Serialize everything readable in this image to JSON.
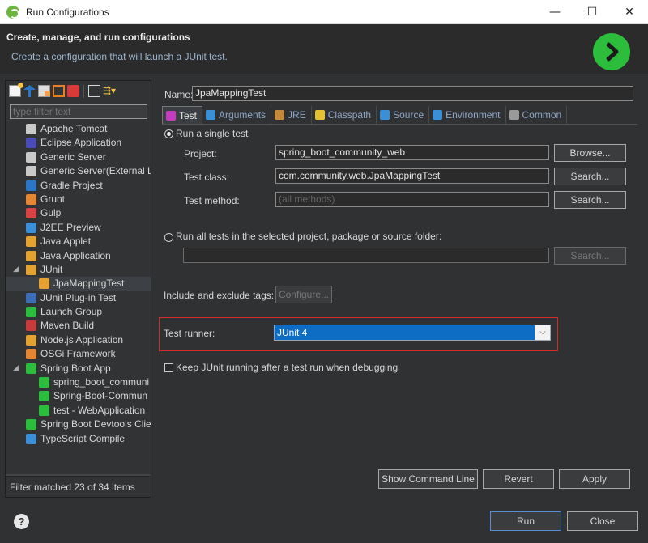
{
  "window": {
    "title": "Run Configurations",
    "minimize": "—",
    "maximize": "☐",
    "close": "✕"
  },
  "header": {
    "title": "Create, manage, and run configurations",
    "subtitle": "Create a configuration that will launch a JUnit test."
  },
  "left": {
    "filter_placeholder": "type filter text",
    "tree": [
      {
        "label": "Apache Tomcat",
        "icon": "tomcat-icon",
        "color": "#c9c9c9",
        "indent": 0
      },
      {
        "label": "Eclipse Application",
        "icon": "eclipse-icon",
        "color": "#4b4bb8",
        "indent": 0
      },
      {
        "label": "Generic Server",
        "icon": "server-icon",
        "color": "#c9c9c9",
        "indent": 0
      },
      {
        "label": "Generic Server(External La",
        "icon": "server-icon",
        "color": "#c9c9c9",
        "indent": 0
      },
      {
        "label": "Gradle Project",
        "icon": "gradle-icon",
        "color": "#2b76c7",
        "indent": 0
      },
      {
        "label": "Grunt",
        "icon": "grunt-icon",
        "color": "#e48632",
        "indent": 0
      },
      {
        "label": "Gulp",
        "icon": "gulp-icon",
        "color": "#d94343",
        "indent": 0
      },
      {
        "label": "J2EE Preview",
        "icon": "j2ee-icon",
        "color": "#3a8fd6",
        "indent": 0
      },
      {
        "label": "Java Applet",
        "icon": "java-applet-icon",
        "color": "#e4a232",
        "indent": 0
      },
      {
        "label": "Java Application",
        "icon": "java-app-icon",
        "color": "#e4a232",
        "indent": 0
      },
      {
        "label": "JUnit",
        "icon": "junit-icon",
        "color": "#e4a232",
        "indent": 0,
        "expanded": true
      },
      {
        "label": "JpaMappingTest",
        "icon": "junit-test-icon",
        "color": "#e4a232",
        "indent": 1,
        "selected": true
      },
      {
        "label": "JUnit Plug-in Test",
        "icon": "junit-plugin-icon",
        "color": "#3a6fb8",
        "indent": 0
      },
      {
        "label": "Launch Group",
        "icon": "launch-group-icon",
        "color": "#2dbd3c",
        "indent": 0
      },
      {
        "label": "Maven Build",
        "icon": "maven-icon",
        "color": "#c73b3b",
        "indent": 0
      },
      {
        "label": "Node.js Application",
        "icon": "nodejs-icon",
        "color": "#e4a232",
        "indent": 0
      },
      {
        "label": "OSGi Framework",
        "icon": "osgi-icon",
        "color": "#e48632",
        "indent": 0
      },
      {
        "label": "Spring Boot App",
        "icon": "spring-boot-icon",
        "color": "#2dbd3c",
        "indent": 0,
        "expanded": true
      },
      {
        "label": "spring_boot_communi",
        "icon": "spring-boot-icon",
        "color": "#2dbd3c",
        "indent": 1
      },
      {
        "label": "Spring-Boot-Commun",
        "icon": "spring-boot-icon",
        "color": "#2dbd3c",
        "indent": 1
      },
      {
        "label": "test - WebApplication",
        "icon": "spring-boot-icon",
        "color": "#2dbd3c",
        "indent": 1
      },
      {
        "label": "Spring Boot Devtools Clie",
        "icon": "spring-devtools-icon",
        "color": "#2dbd3c",
        "indent": 0
      },
      {
        "label": "TypeScript Compile",
        "icon": "typescript-icon",
        "color": "#3a8fd6",
        "indent": 0
      }
    ],
    "status": "Filter matched 23 of 34 items"
  },
  "config": {
    "name_label": "Name:",
    "name_value": "JpaMappingTest",
    "tabs": [
      {
        "label": "Test",
        "icon": "test-tab-icon",
        "color": "#c73bc0",
        "active": true
      },
      {
        "label": "Arguments",
        "icon": "arguments-tab-icon",
        "color": "#3a8fd6"
      },
      {
        "label": "JRE",
        "icon": "jre-tab-icon",
        "color": "#c48a3a"
      },
      {
        "label": "Classpath",
        "icon": "classpath-tab-icon",
        "color": "#e4c232"
      },
      {
        "label": "Source",
        "icon": "source-tab-icon",
        "color": "#3a8fd6"
      },
      {
        "label": "Environment",
        "icon": "environment-tab-icon",
        "color": "#3a8fd6"
      },
      {
        "label": "Common",
        "icon": "common-tab-icon",
        "color": "#9a9a9a"
      }
    ],
    "single_test_label": "Run a single test",
    "project_label": "Project:",
    "project_value": "spring_boot_community_web",
    "browse_label": "Browse...",
    "test_class_label": "Test class:",
    "test_class_value": "com.community.web.JpaMappingTest",
    "search_label": "Search...",
    "test_method_label": "Test method:",
    "test_method_placeholder": "(all methods)",
    "search_method_label": "Search...",
    "run_all_label": "Run all tests in the selected project, package or source folder:",
    "run_all_value": "",
    "search_all_label": "Search...",
    "tags_label": "Include and exclude tags:",
    "configure_label": "Configure...",
    "runner_label": "Test runner:",
    "runner_value": "JUnit 4",
    "keep_running_label": "Keep JUnit running after a test run when debugging",
    "show_cmd_label": "Show Command Line",
    "revert_label": "Revert",
    "apply_label": "Apply"
  },
  "footer": {
    "help": "?",
    "run_label": "Run",
    "close_label": "Close"
  }
}
